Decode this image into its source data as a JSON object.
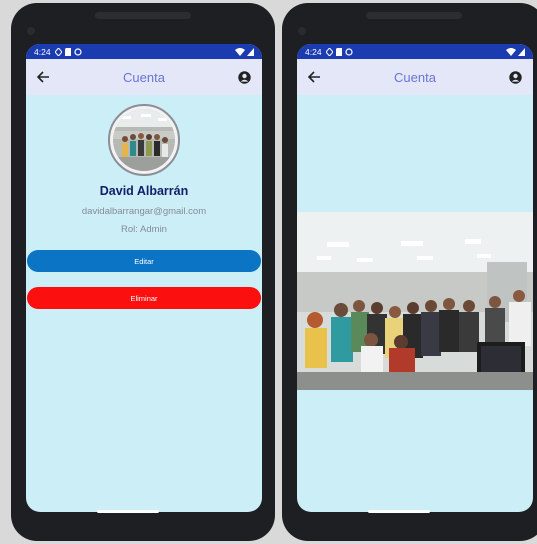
{
  "status": {
    "time": "4:24"
  },
  "appbar": {
    "title": "Cuenta"
  },
  "profile": {
    "name": "David Albarrán",
    "email": "davidalbarrangar@gmail.com",
    "role": "Rol: Admin"
  },
  "buttons": {
    "edit": "Editar",
    "delete": "Eliminar"
  },
  "colors": {
    "accent_edit": "#0b74c4",
    "accent_delete": "#fb0f0f",
    "background": "#cceef6",
    "title": "#6b74d6",
    "name": "#12206b"
  },
  "icons": [
    "back-arrow-icon",
    "account-circle-icon",
    "wifi-icon",
    "battery-icon"
  ]
}
